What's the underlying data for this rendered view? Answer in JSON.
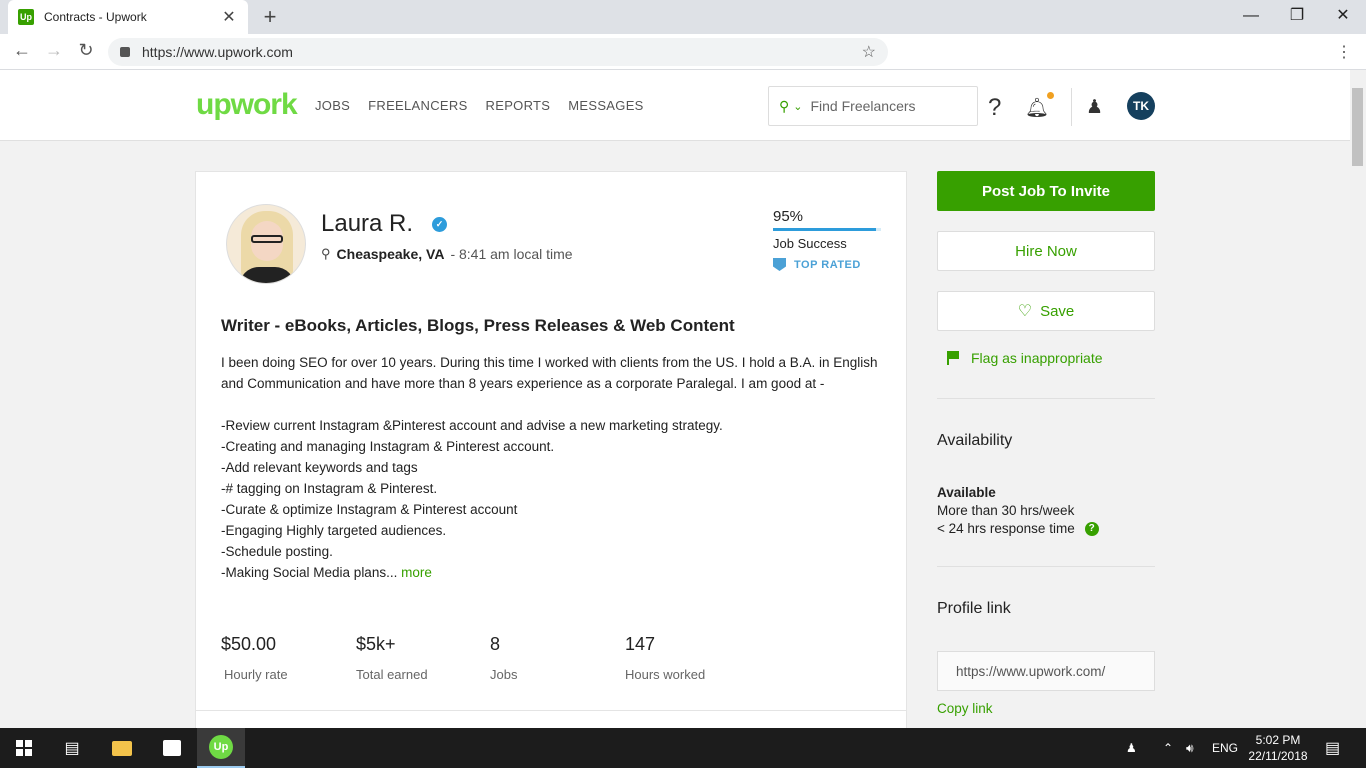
{
  "browser": {
    "tab_title": "Contracts - Upwork",
    "favicon_text": "Up",
    "url": "https://www.upwork.com"
  },
  "header": {
    "logo": "upwork",
    "nav": [
      "JOBS",
      "FREELANCERS",
      "REPORTS",
      "MESSAGES"
    ],
    "search_placeholder": "Find Freelancers",
    "help_icon": "?",
    "avatar_initials": "TK"
  },
  "profile": {
    "name": "Laura R.",
    "location": "Cheaspeake, VA",
    "local_time": "- 8:41 am local time",
    "job_success": "95%",
    "job_success_fraction": 0.95,
    "job_success_label": "Job Success",
    "badge": "TOP RATED",
    "title": "Writer - eBooks, Articles, Blogs, Press Releases & Web Content",
    "intro": "I been doing SEO for over 10 years. During this time I worked with clients from the US. I hold a B.A. in English and Communication and have more than 8 years experience as a corporate Paralegal. I am good at -",
    "bullets": [
      "-Review current Instagram &Pinterest account and advise a new marketing strategy.",
      "-Creating and managing Instagram & Pinterest account.",
      "-Add relevant keywords and tags",
      "-# tagging on Instagram & Pinterest.",
      "-Curate & optimize Instagram & Pinterest account",
      "-Engaging Highly targeted audiences.",
      "-Schedule posting."
    ],
    "last_bullet": "-Making Social Media plans...",
    "more_label": "more",
    "stats": [
      {
        "value": "$50.00",
        "label": "Hourly rate"
      },
      {
        "value": "$5k+",
        "label": "Total earned"
      },
      {
        "value": "8",
        "label": "Jobs"
      },
      {
        "value": "147",
        "label": "Hours worked"
      }
    ]
  },
  "sidebar": {
    "post_job": "Post Job To Invite",
    "hire_now": "Hire Now",
    "save": "Save",
    "flag": "Flag as inappropriate",
    "availability_heading": "Availability",
    "available": "Available",
    "hours": "More than 30 hrs/week",
    "response": "< 24 hrs response time",
    "profile_link_heading": "Profile link",
    "profile_link": "https://www.upwork.com/",
    "copy_link": "Copy link"
  },
  "taskbar": {
    "lang": "ENG",
    "time": "5:02 PM",
    "date": "22/11/2018"
  },
  "colors": {
    "brand_green": "#37a000",
    "logo_green": "#6fda44",
    "top_rated_blue": "#4ba1d6"
  }
}
